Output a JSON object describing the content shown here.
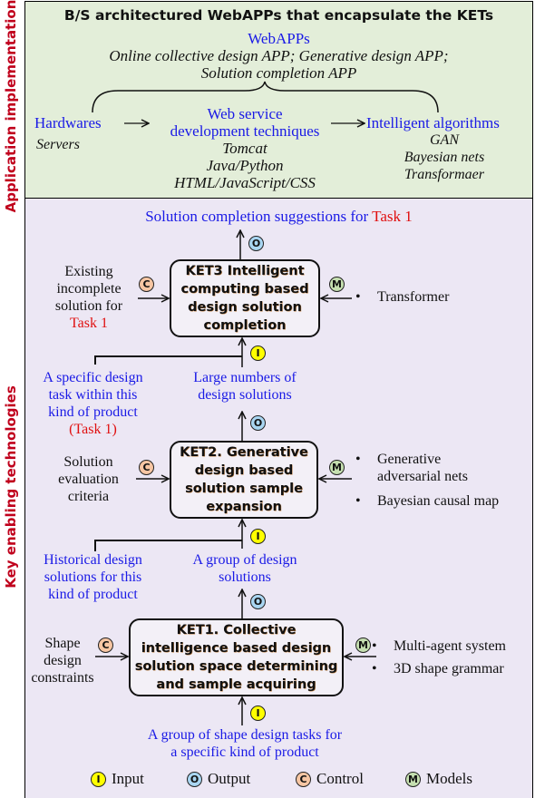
{
  "side_labels": {
    "top": "Application implementation",
    "bottom": "Key enabling technologies"
  },
  "top_panel": {
    "title": "B/S architectured WebAPPs that encapsulate the KETs",
    "webapps_heading": "WebAPPs",
    "webapps_line1": "Online collective design APP; Generative design APP;",
    "webapps_line2": "Solution completion APP",
    "hardwares": {
      "heading": "Hardwares",
      "items": [
        "Servers"
      ]
    },
    "web_service": {
      "heading_line1": "Web service",
      "heading_line2": "development techniques",
      "items": [
        "Tomcat",
        "Java/Python",
        "HTML/JavaScript/CSS"
      ]
    },
    "algorithms": {
      "heading": "Intelligent algorithms",
      "items": [
        "GAN",
        "Bayesian nets",
        "Transformaer"
      ]
    }
  },
  "badges": {
    "input": "I",
    "output": "O",
    "control": "C",
    "model": "M"
  },
  "colors": {
    "input": "#ffff00",
    "output": "#a9d6f2",
    "control": "#f7c6a3",
    "model": "#c5dfb0",
    "flow_text": "#1a1ae6",
    "task_text": "#e01010",
    "side_label": "#c0001c",
    "top_panel_bg": "#e3eed9",
    "bottom_panel_bg": "#ece7f4"
  },
  "ket3": {
    "title_lines": [
      "KET3 Intelligent",
      "computing based",
      "design solution",
      "completion"
    ],
    "output": {
      "text": "Solution completion suggestions for ",
      "task": "Task 1"
    },
    "control": {
      "lines": [
        "Existing",
        "incomplete",
        "solution for"
      ],
      "task": "Task 1"
    },
    "models": [
      "Transformer"
    ]
  },
  "ket3_inputs": {
    "left": {
      "lines": [
        "A specific design",
        "task within this",
        "kind of product"
      ],
      "task": "(Task 1)"
    },
    "right": {
      "lines": [
        "Large numbers of",
        "design solutions"
      ]
    }
  },
  "ket2": {
    "title_lines": [
      "KET2. Generative",
      "design based",
      "solution sample",
      "expansion"
    ],
    "control": {
      "lines": [
        "Solution",
        "evaluation",
        "criteria"
      ]
    },
    "models": [
      "Generative adversarial nets",
      "Bayesian causal map"
    ],
    "models_wrapped": [
      [
        "Generative",
        "adversarial nets"
      ],
      [
        "Bayesian causal map"
      ]
    ]
  },
  "ket2_inputs": {
    "left": {
      "lines": [
        "Historical design",
        "solutions for this",
        "kind of product"
      ]
    },
    "right": {
      "lines": [
        "A group of design",
        "solutions"
      ]
    }
  },
  "ket1": {
    "title_lines": [
      "KET1. Collective",
      "intelligence based design",
      "solution space determining",
      "and sample acquiring"
    ],
    "control": {
      "lines": [
        "Shape",
        "design",
        "constraints"
      ]
    },
    "models": [
      "Multi-agent system",
      "3D shape grammar"
    ],
    "input": {
      "lines": [
        "A group of shape design tasks for",
        "a specific kind of product"
      ]
    }
  },
  "legend": [
    {
      "badge": "I",
      "label": "Input",
      "kind": "input"
    },
    {
      "badge": "O",
      "label": "Output",
      "kind": "output"
    },
    {
      "badge": "C",
      "label": "Control",
      "kind": "control"
    },
    {
      "badge": "M",
      "label": "Models",
      "kind": "model"
    }
  ]
}
